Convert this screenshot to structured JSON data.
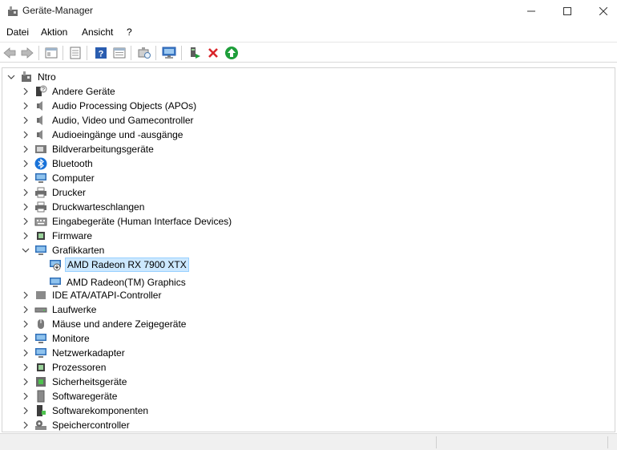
{
  "window": {
    "title": "Geräte-Manager"
  },
  "menu": {
    "items": [
      "Datei",
      "Aktion",
      "Ansicht",
      "?"
    ]
  },
  "tree": {
    "root": "Ntro",
    "categories": [
      "Andere Geräte",
      "Audio Processing Objects (APOs)",
      "Audio, Video und Gamecontroller",
      "Audioeingänge und -ausgänge",
      "Bildverarbeitungsgeräte",
      "Bluetooth",
      "Computer",
      "Drucker",
      "Druckwarteschlangen",
      "Eingabegeräte (Human Interface Devices)",
      "Firmware",
      "Grafikkarten",
      "IDE ATA/ATAPI-Controller",
      "Laufwerke",
      "Mäuse und andere Zeigegeräte",
      "Monitore",
      "Netzwerkadapter",
      "Prozessoren",
      "Sicherheitsgeräte",
      "Softwaregeräte",
      "Softwarekomponenten",
      "Speichercontroller"
    ],
    "grafikkarten_children": [
      "AMD Radeon RX 7900 XTX",
      "AMD Radeon(TM) Graphics"
    ]
  },
  "colors": {
    "selection_bg": "#cce8ff",
    "selection_border": "#99d1ff",
    "remove_red": "#d9252a",
    "update_green": "#1e9e3a",
    "help_blue": "#2a5db0"
  },
  "icons": {
    "toolbar": [
      "back-arrow-icon",
      "forward-arrow-icon",
      "properties-icon",
      "show-hidden-icon",
      "help-icon",
      "view-icon",
      "scan-hardware-icon",
      "monitor-icon",
      "enable-device-icon",
      "uninstall-device-icon",
      "update-driver-icon"
    ]
  }
}
